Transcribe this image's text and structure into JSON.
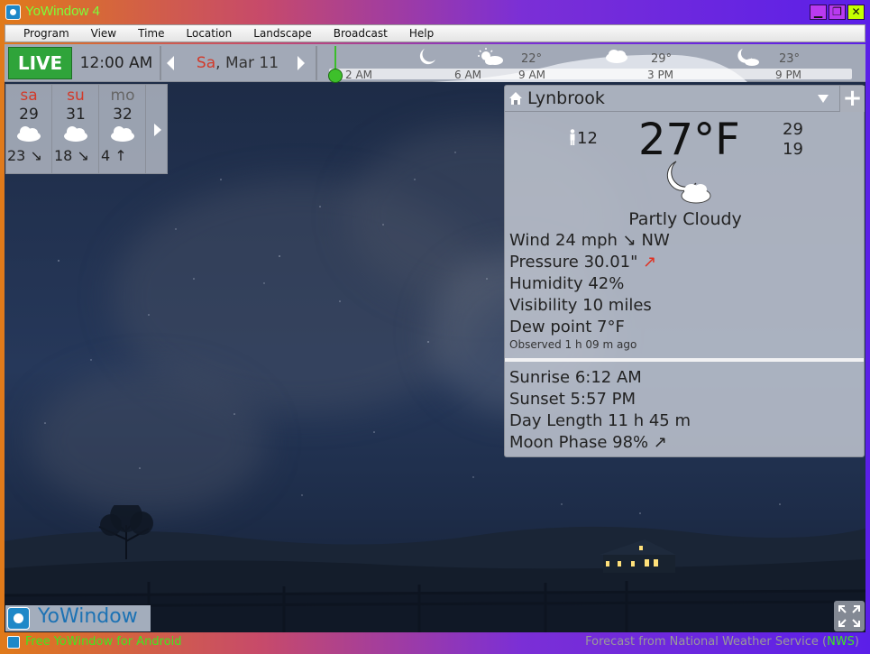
{
  "window": {
    "title": "YoWindow 4"
  },
  "menu": [
    "Program",
    "View",
    "Time",
    "Location",
    "Landscape",
    "Broadcast",
    "Help"
  ],
  "topbar": {
    "live_label": "LIVE",
    "time": "12:00 AM",
    "date_day": "Sa",
    "date_rest": ", Mar 11"
  },
  "timeline": {
    "labels": [
      "2 AM",
      "6 AM",
      "9 AM",
      "3 PM",
      "9 PM"
    ],
    "temps": [
      "22°",
      "29°",
      "23°"
    ]
  },
  "forecast": [
    {
      "day": "sa",
      "high": "29",
      "low": "23 ↘",
      "weekend": true
    },
    {
      "day": "su",
      "high": "31",
      "low": "18 ↘",
      "weekend": true
    },
    {
      "day": "mo",
      "high": "32",
      "low": "4 ↑",
      "weekend": false
    }
  ],
  "current": {
    "location": "Lynbrook",
    "feels_like": "12",
    "temperature": "27°F",
    "high": "29",
    "low": "19",
    "condition": "Partly Cloudy",
    "wind": "Wind  24 mph ↘ NW",
    "pressure_label": "Pressure  30.01\"",
    "pressure_trend": "↗",
    "humidity": "Humidity  42%",
    "visibility": "Visibility  10 miles",
    "dew_point": "Dew point  7°F",
    "observed": "Observed 1 h 09 m ago",
    "sunrise": "Sunrise  6:12 AM",
    "sunset": "Sunset  5:57 PM",
    "day_length": "Day Length  11 h 45 m",
    "moon_phase": "Moon Phase  98% ↗"
  },
  "bottom": {
    "logo": "YoWindow",
    "android_link": "Free YoWindow for Android",
    "forecast_credit_pre": "Forecast from National Weather Service (",
    "forecast_credit_nws": "NWS",
    "forecast_credit_post": ")"
  },
  "colors": {
    "live": "#2fa43a",
    "weekend": "#d23a2a",
    "status_green": "#3fe81f"
  }
}
